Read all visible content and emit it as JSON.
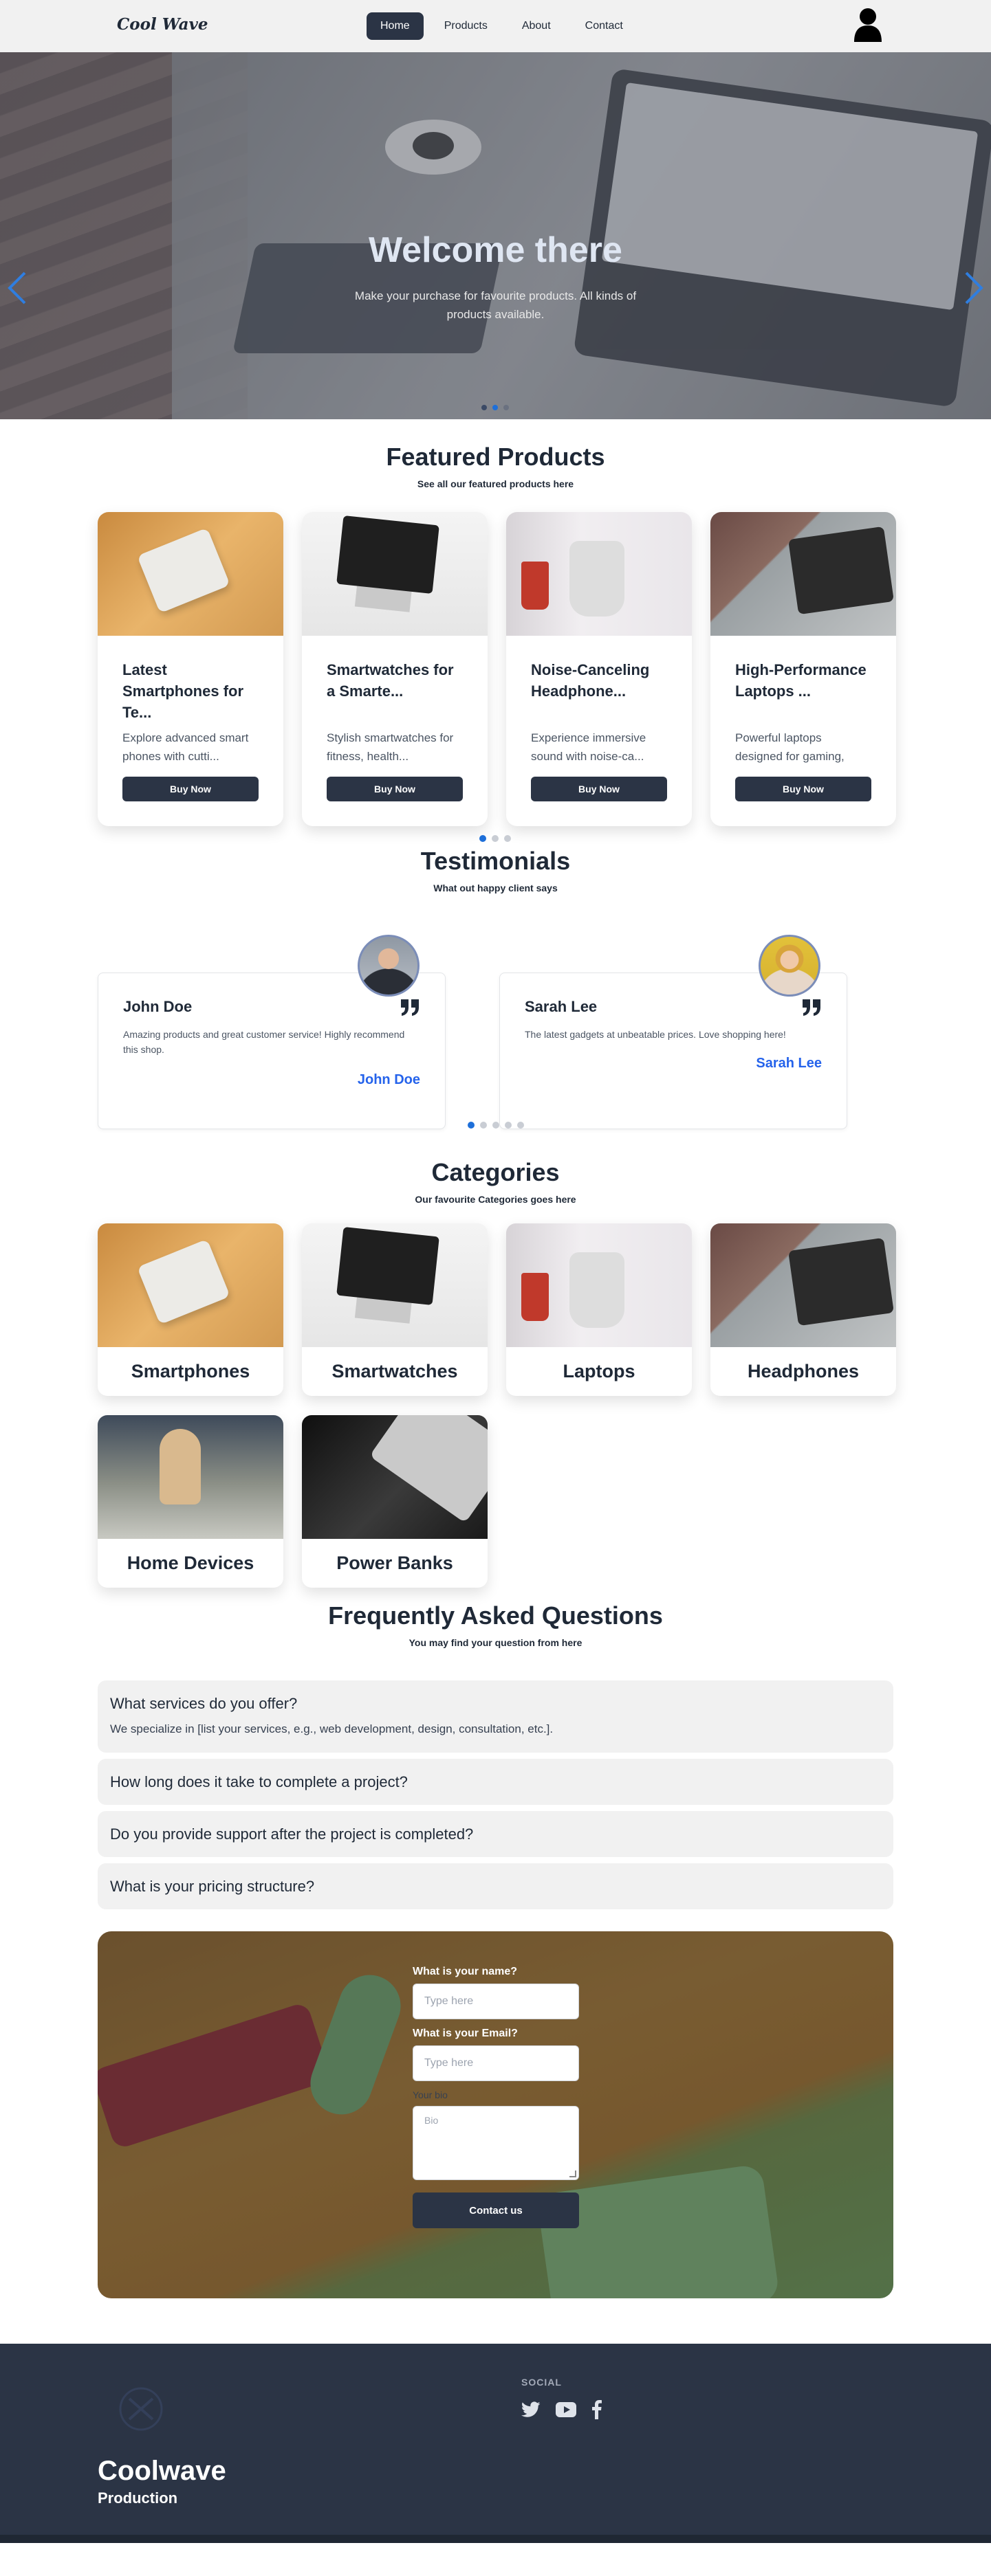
{
  "header": {
    "logo": "Cool Wave",
    "nav": [
      "Home",
      "Products",
      "About",
      "Contact"
    ],
    "active": "Home",
    "profile_icon": "user-icon"
  },
  "hero": {
    "title": "Welcome there",
    "subtitle": "Make your purchase for favourite products. All kinds of products available.",
    "prev_icon": "chevron-left-icon",
    "next_icon": "chevron-right-icon"
  },
  "products": {
    "title": "Featured Products",
    "subtitle": "See all our featured products here",
    "items": [
      {
        "title": "Latest Smartphones for Te...",
        "desc": "Explore advanced smart phones with cutti...",
        "button": "Buy Now"
      },
      {
        "title": "Smartwatches for a Smarte...",
        "desc": "Stylish smartwatches for fitness, health...",
        "button": "Buy Now"
      },
      {
        "title": "Noise-Canceling Headphone...",
        "desc": "Experience immersive sound with noise-ca...",
        "button": "Buy Now"
      },
      {
        "title": "High-Performance Laptops ...",
        "desc": "Powerful laptops designed for gaming, wo...",
        "button": "Buy Now"
      }
    ],
    "pages": 3,
    "active_page": 1
  },
  "testimonials": {
    "title": "Testimonials",
    "subtitle": "What out happy client says",
    "items": [
      {
        "name": "John Doe",
        "text": "Amazing products and great customer service! Highly recommend this shop.",
        "signature": "John Doe"
      },
      {
        "name": "Sarah Lee",
        "text": "The latest gadgets at unbeatable prices. Love shopping here!",
        "signature": "Sarah Lee"
      }
    ],
    "pages": 5,
    "active_page": 1
  },
  "categories": {
    "title": "Categories",
    "subtitle": "Our favourite Categories goes here",
    "items": [
      "Smartphones",
      "Smartwatches",
      "Laptops",
      "Headphones",
      "Home Devices",
      "Power Banks"
    ]
  },
  "faq": {
    "title": "Frequently Asked Questions",
    "subtitle": "You may find your question from here",
    "items": [
      {
        "q": "What services do you offer?",
        "a": "We specialize in [list your services, e.g., web development, design, consultation, etc.]."
      },
      {
        "q": "How long does it take to complete a project?",
        "a": ""
      },
      {
        "q": "Do you provide support after the project is completed?",
        "a": ""
      },
      {
        "q": "What is your pricing structure?",
        "a": ""
      }
    ]
  },
  "contact": {
    "name_label": "What is your name?",
    "name_placeholder": "Type here",
    "email_label": "What is your Email?",
    "email_placeholder": "Type here",
    "bio_label": "Your bio",
    "bio_placeholder": "Bio",
    "button": "Contact us"
  },
  "footer": {
    "social_title": "SOCIAL",
    "social_icons": [
      "twitter-icon",
      "youtube-icon",
      "facebook-icon"
    ],
    "brand": "Coolwave",
    "tagline": "Production"
  },
  "colors": {
    "primary_dark": "#2b3445",
    "accent_blue": "#1e6fd9",
    "footer_bg": "#2b3445"
  }
}
